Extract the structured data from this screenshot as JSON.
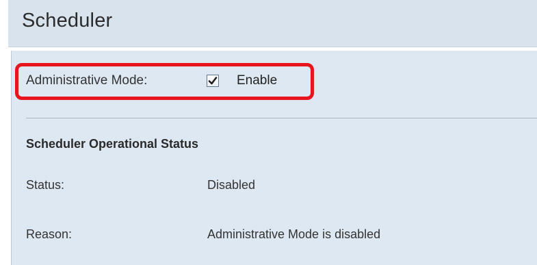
{
  "header": {
    "title": "Scheduler"
  },
  "admin_mode": {
    "label": "Administrative Mode:",
    "checkbox_checked": true,
    "option_label": "Enable",
    "highlight_color": "#e8141e"
  },
  "operational_status": {
    "heading": "Scheduler Operational Status",
    "fields": [
      {
        "label": "Status:",
        "value": "Disabled"
      },
      {
        "label": "Reason:",
        "value": "Administrative Mode is disabled"
      }
    ]
  }
}
